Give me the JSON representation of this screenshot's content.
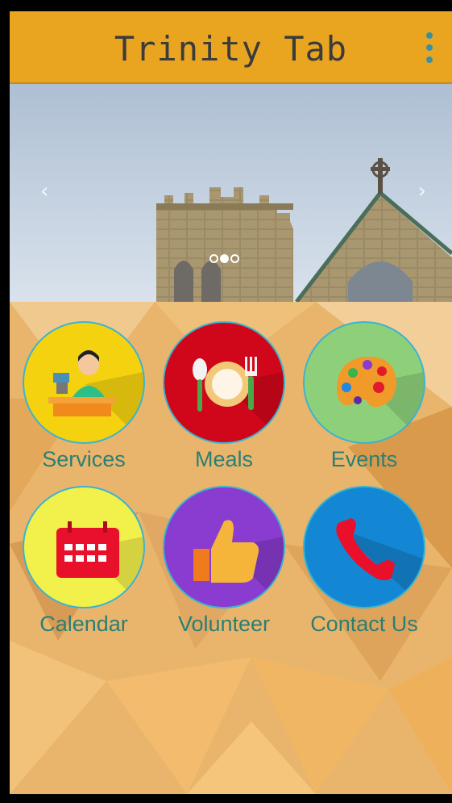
{
  "app": {
    "title": "Trinity Tab"
  },
  "carousel": {
    "prev_glyph": "‹",
    "next_glyph": "›",
    "slide_count": 3,
    "active_index": 1
  },
  "tiles": [
    {
      "label": "Services",
      "icon": "cashier-icon",
      "color": "#f5d20f"
    },
    {
      "label": "Meals",
      "icon": "dinner-plate-icon",
      "color": "#d0061a"
    },
    {
      "label": "Events",
      "icon": "palette-icon",
      "color": "#8ed07a"
    },
    {
      "label": "Calendar",
      "icon": "calendar-icon",
      "color": "#f2f04a"
    },
    {
      "label": "Volunteer",
      "icon": "thumbs-up-icon",
      "color": "#8a3bd0"
    },
    {
      "label": "Contact Us",
      "icon": "phone-icon",
      "color": "#1487d4"
    }
  ],
  "colors": {
    "appbar": "#eaa520",
    "label_text": "#2a7f75",
    "ring": "#39b4d1"
  }
}
